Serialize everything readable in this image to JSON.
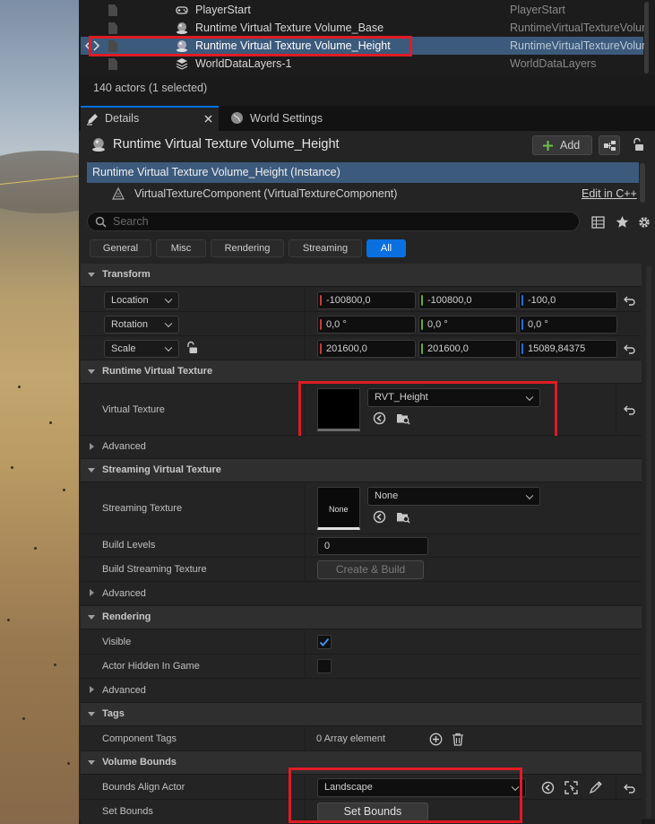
{
  "outliner": {
    "rows": [
      {
        "name": "PlayerStart",
        "type": "PlayerStart",
        "icon": "player-start-icon",
        "selected": false
      },
      {
        "name": "Runtime Virtual Texture Volume_Base",
        "type": "RuntimeVirtualTextureVolume",
        "icon": "virtual-texture-volume-icon",
        "selected": false
      },
      {
        "name": "Runtime Virtual Texture Volume_Height",
        "type": "RuntimeVirtualTextureVolume",
        "icon": "virtual-texture-volume-icon",
        "selected": true
      },
      {
        "name": "WorldDataLayers-1",
        "type": "WorldDataLayers",
        "icon": "layers-icon",
        "selected": false
      }
    ],
    "status": "140 actors (1 selected)"
  },
  "tabs": {
    "details": "Details",
    "world_settings": "World Settings"
  },
  "actor": {
    "name": "Runtime Virtual Texture Volume_Height",
    "add_label": "Add",
    "instance_label": "Runtime Virtual Texture Volume_Height (Instance)",
    "component_label": "VirtualTextureComponent (VirtualTextureComponent)",
    "edit_cpp": "Edit in C++"
  },
  "search": {
    "placeholder": "Search"
  },
  "filters": [
    "General",
    "Misc",
    "Rendering",
    "Streaming",
    "All"
  ],
  "active_filter": "All",
  "transform": {
    "title": "Transform",
    "location": {
      "label": "Location",
      "x": "-100800,0",
      "y": "-100800,0",
      "z": "-100,0"
    },
    "rotation": {
      "label": "Rotation",
      "x": "0,0 °",
      "y": "0,0 °",
      "z": "0,0 °"
    },
    "scale": {
      "label": "Scale",
      "x": "201600,0",
      "y": "201600,0",
      "z": "15089,84375"
    }
  },
  "rvt": {
    "title": "Runtime Virtual Texture",
    "virtual_texture_label": "Virtual Texture",
    "virtual_texture_value": "RVT_Height",
    "advanced": "Advanced"
  },
  "svt": {
    "title": "Streaming Virtual Texture",
    "streaming_texture_label": "Streaming Texture",
    "streaming_texture_thumb": "None",
    "streaming_texture_value": "None",
    "build_levels_label": "Build Levels",
    "build_levels_value": "0",
    "build_streaming_label": "Build Streaming Texture",
    "create_build": "Create & Build",
    "advanced": "Advanced"
  },
  "rendering": {
    "title": "Rendering",
    "visible_label": "Visible",
    "visible": true,
    "hidden_label": "Actor Hidden In Game",
    "hidden": false,
    "advanced": "Advanced"
  },
  "tags": {
    "title": "Tags",
    "component_tags_label": "Component Tags",
    "component_tags_value": "0 Array element"
  },
  "bounds": {
    "title": "Volume Bounds",
    "align_label": "Bounds Align Actor",
    "align_value": "Landscape",
    "set_bounds_label": "Set Bounds",
    "set_bounds_button": "Set Bounds"
  },
  "colors": {
    "selection": "#3c5a7c",
    "accent": "#0a70e0",
    "highlight_box": "#e01b24",
    "axis_x": "#c83c3c",
    "axis_y": "#6aa83a",
    "axis_z": "#2a6ad8"
  }
}
